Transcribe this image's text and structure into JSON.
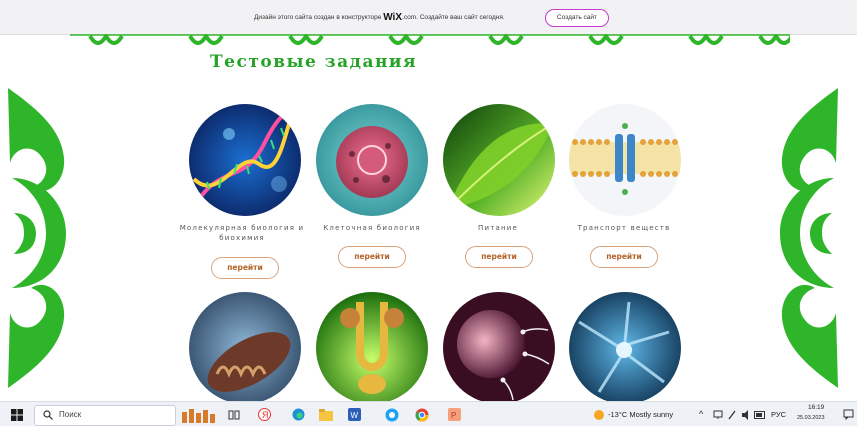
{
  "banner": {
    "text_before": "Дизайн этого сайта создан в конструкторе",
    "logo": "WiX",
    "text_after": ".com. Создайте ваш сайт сегодня.",
    "button_label": "Создать сайт"
  },
  "page": {
    "title": "Тестовые задания",
    "accent_color": "#2fb52a"
  },
  "cards": [
    {
      "label": "Молекулярная биология  и биохимия",
      "button": "перейти",
      "image": "dna-image"
    },
    {
      "label": "Клеточная биология",
      "button": "перейти",
      "image": "cell-image"
    },
    {
      "label": "Питание",
      "button": "перейти",
      "image": "leaf-image"
    },
    {
      "label": "Транспорт веществ",
      "button": "перейти",
      "image": "membrane-channel-image"
    },
    {
      "image": "mitochondria-image"
    },
    {
      "image": "kidney-image"
    },
    {
      "image": "egg-sperm-image"
    },
    {
      "image": "neuron-image"
    }
  ],
  "taskbar": {
    "search_placeholder": "Поиск",
    "weather": "-13°C  Mostly sunny",
    "language": "РУС",
    "time": "16:19",
    "date": "25.03.2023"
  }
}
